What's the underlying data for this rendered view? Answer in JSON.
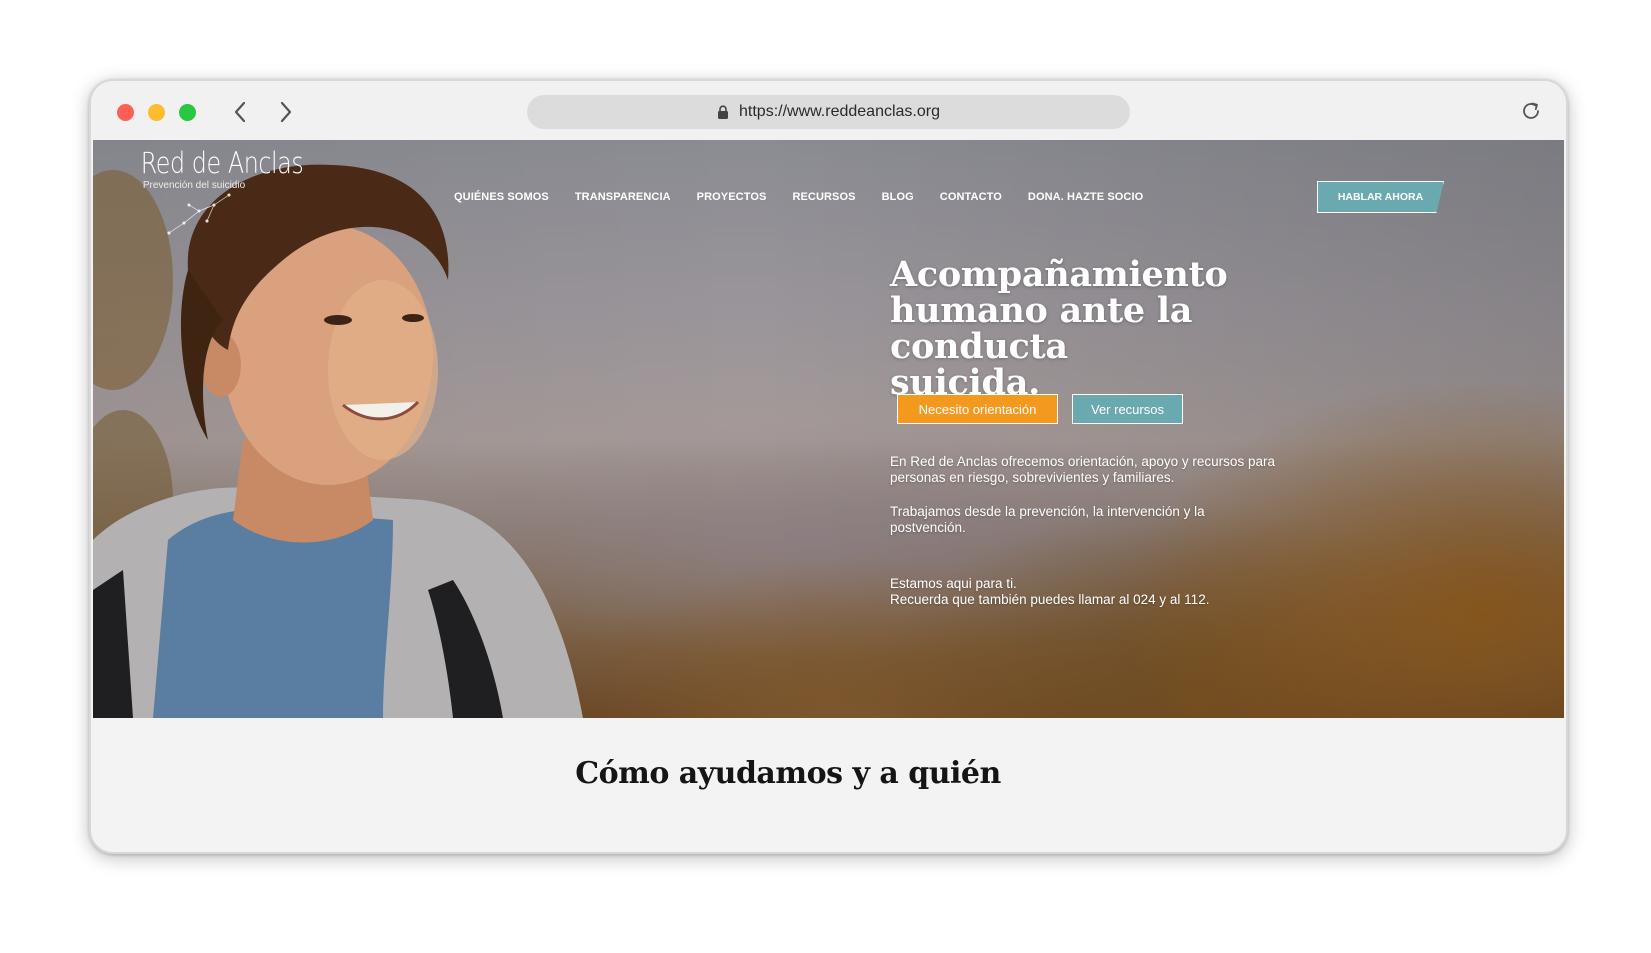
{
  "browser": {
    "url": "https://www.reddeanclas.org"
  },
  "site": {
    "logo_title": "Red de Anclas",
    "logo_subtitle": "Prevención del suicidio",
    "nav": [
      "QUIÉNES SOMOS",
      "TRANSPARENCIA",
      "PROYECTOS",
      "RECURSOS",
      "BLOG",
      "CONTACTO",
      "DONA. HAZTE SOCIO"
    ],
    "cta_label": "HABLAR AHORA"
  },
  "hero": {
    "headline_lines": [
      "Acompañamiento",
      "humano ante la conducta",
      "suicida."
    ],
    "primary_button": "Necesito orientación",
    "secondary_button": "Ver recursos",
    "paragraph_1_lines": [
      "En Red de Anclas ofrecemos orientación, apoyo y recursos para",
      "personas en riesgo, sobrevivientes y familiares."
    ],
    "paragraph_2_lines": [
      "Trabajamos desde la prevención, la intervención y la",
      "postvención."
    ],
    "paragraph_3_lines": [
      "Estamos aqui para ti.",
      "Recuerda que también puedes llamar al 024  y al 112."
    ]
  },
  "section": {
    "title": "Cómo ayudamos y a quién"
  },
  "colors": {
    "orange": "#f39a1e",
    "teal": "#6ba9b0"
  }
}
